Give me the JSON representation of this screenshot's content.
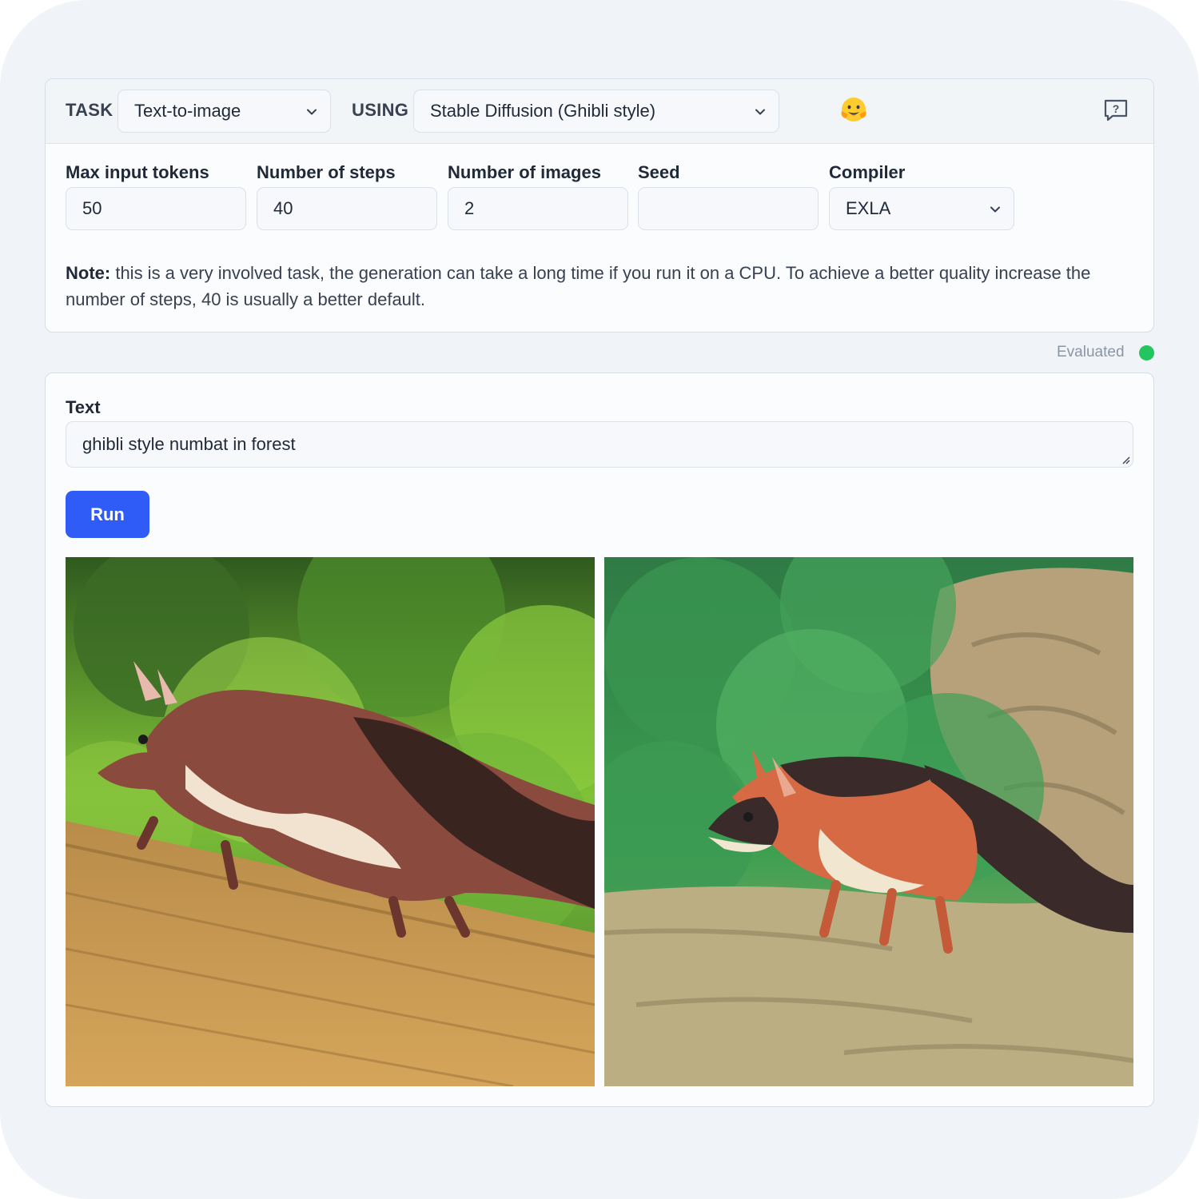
{
  "header": {
    "task_label": "TASK",
    "task_value": "Text-to-image",
    "using_label": "USING",
    "using_value": "Stable Diffusion (Ghibli style)",
    "icons": [
      "hugging-face-emoji-icon",
      "help-chat-icon",
      "chevron-down-icon"
    ]
  },
  "params": {
    "max_tokens": {
      "label": "Max input tokens",
      "value": "50"
    },
    "steps": {
      "label": "Number of steps",
      "value": "40"
    },
    "images": {
      "label": "Number of images",
      "value": "2"
    },
    "seed": {
      "label": "Seed",
      "value": ""
    },
    "compiler": {
      "label": "Compiler",
      "value": "EXLA"
    }
  },
  "note": {
    "bold": "Note:",
    "text": " this is a very involved task, the generation can take a long time if you run it on a CPU. To achieve a better quality increase the number of steps, 40 is usually a better default."
  },
  "status": {
    "text": "Evaluated",
    "color": "#22c55e"
  },
  "prompt": {
    "label": "Text",
    "value": "ghibli style numbat in forest"
  },
  "run_button": {
    "label": "Run",
    "color": "#2f5cf6"
  },
  "outputs": [
    {
      "subject": "numbat on log, forest background"
    },
    {
      "subject": "numbat on rocks, bushes background"
    }
  ]
}
